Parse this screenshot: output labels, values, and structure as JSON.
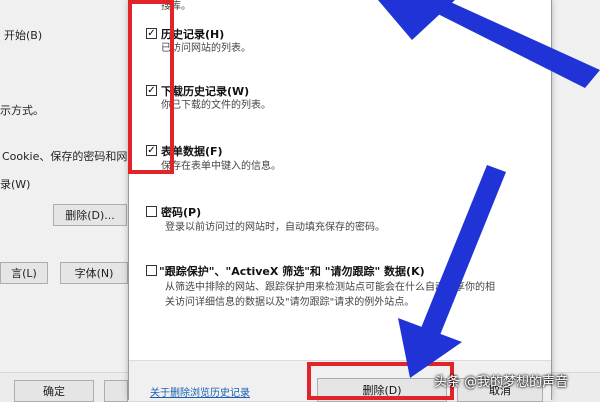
{
  "left_panel": {
    "t1": "开始(B)",
    "t2": "示方式。",
    "t3": "Cookie、保存的密码和网",
    "t4": "录(W)",
    "delete_btn": "删除(D)...",
    "lang_btn": "言(L)",
    "font_btn": "字体(N)",
    "ok_btn": "确定"
  },
  "dialog": {
    "top_desc": "搜库。",
    "options": [
      {
        "title": "历史记录(H)",
        "desc": "已访问网站的列表。",
        "checked": true
      },
      {
        "title": "下载历史记录(W)",
        "desc": "你已下载的文件的列表。",
        "checked": true
      },
      {
        "title": "表单数据(F)",
        "desc": "保存在表单中键入的信息。",
        "checked": true
      },
      {
        "title": "密码(P)",
        "desc": "登录以前访问过的网站时，自动填充保存的密码。",
        "checked": false
      },
      {
        "title": "\"跟踪保护\"、\"ActiveX 筛选\"和 \"请勿跟踪\" 数据(K)",
        "desc1": "从筛选中排除的网站、跟踪保护用来检测站点可能会在什么自动共享你的相",
        "desc2": "关访问详细信息的数据以及\"请勿跟踪\"请求的例外站点。",
        "checked": false
      }
    ],
    "about_link": "关于删除浏览历史记录",
    "delete_btn": "删除(D)",
    "cancel_btn": "取消"
  },
  "watermark": "头条 @我的梦想的声音",
  "colors": {
    "highlight": "#e0242a",
    "arrow": "#1f33d6"
  }
}
